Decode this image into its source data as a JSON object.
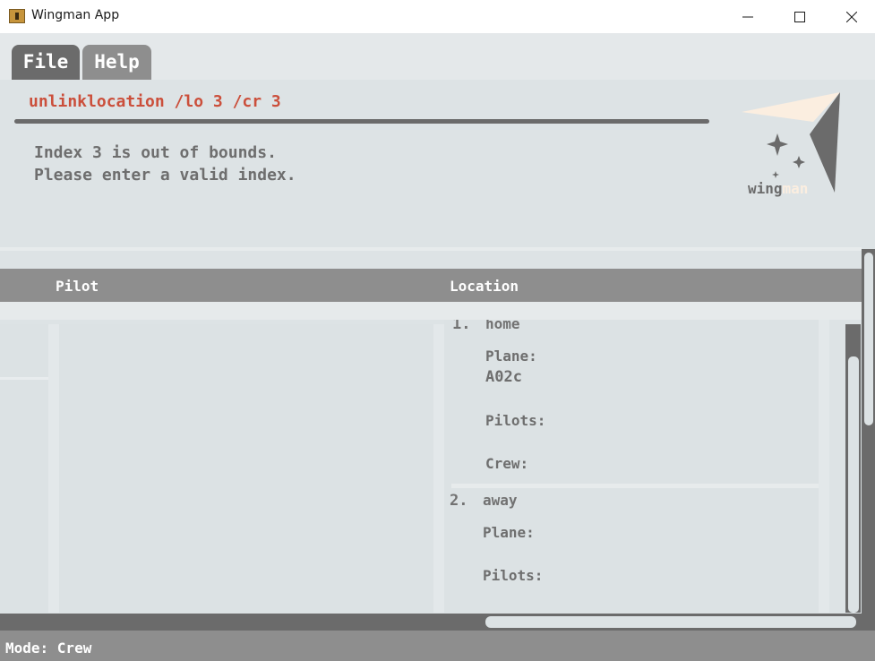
{
  "window": {
    "title": "Wingman App"
  },
  "menu": {
    "file_label": "File",
    "help_label": "Help"
  },
  "command": {
    "text": "unlinklocation /lo 3 /cr 3"
  },
  "result": {
    "text": "Index 3 is out of bounds.\nPlease enter a valid index."
  },
  "logo": {
    "text_part1": "wing",
    "text_part2": "man"
  },
  "table": {
    "headers": {
      "pilot": "Pilot",
      "location": "Location"
    }
  },
  "locations": [
    {
      "index": "1.",
      "name": "home",
      "plane_label": "Plane:",
      "plane_value": "A02c",
      "pilots_label": "Pilots:",
      "crew_label": "Crew:"
    },
    {
      "index": "2.",
      "name": "away",
      "plane_label": "Plane:",
      "pilots_label": "Pilots:"
    }
  ],
  "status": {
    "text": "Mode: Crew"
  },
  "colors": {
    "command_text": "#cb4f3b",
    "tab_active": "#6b6b6b",
    "tab_inactive": "#8e8e8e",
    "background": "#dde3e5"
  }
}
